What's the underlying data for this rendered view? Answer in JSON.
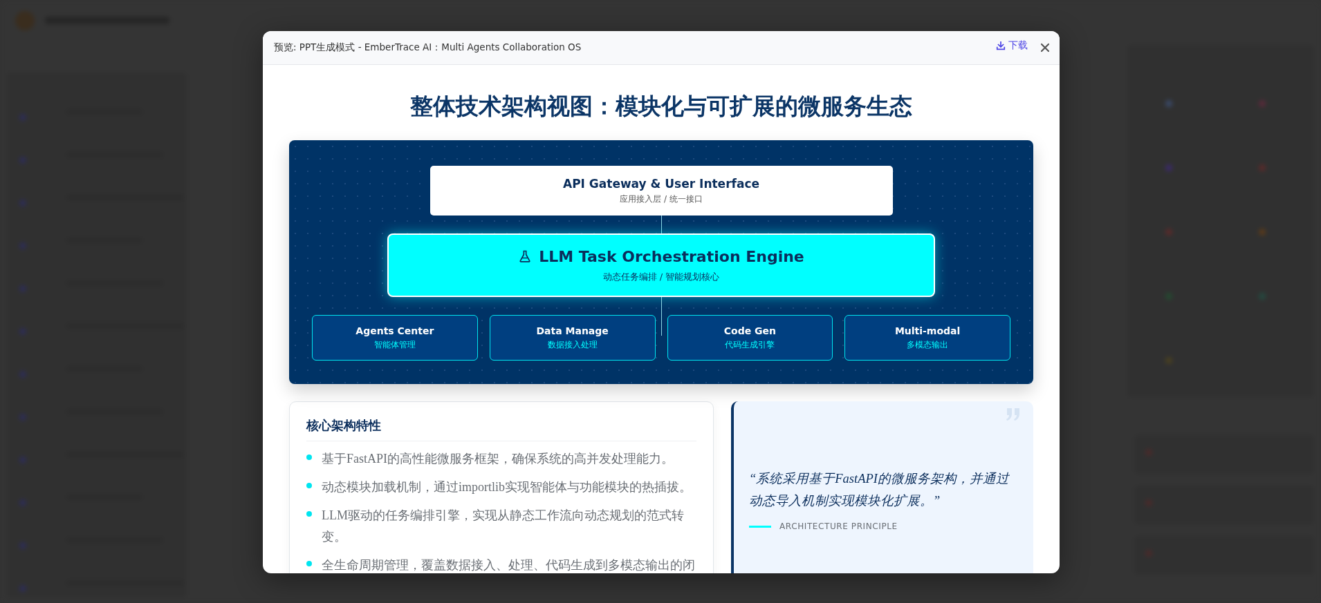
{
  "dialog": {
    "title": "预览: PPT生成模式 - EmberTrace AI：Multi Agents Collaboration OS",
    "download_label": "下载"
  },
  "slide": {
    "title": "整体技术架构视图：模块化与可扩展的微服务生态",
    "architecture": {
      "gateway": {
        "title": "API Gateway & User Interface",
        "subtitle": "应用接入层 / 统一接口"
      },
      "engine": {
        "title": "LLM Task Orchestration Engine",
        "subtitle": "动态任务编排 / 智能规划核心"
      },
      "modules": [
        {
          "title": "Agents Center",
          "subtitle": "智能体管理"
        },
        {
          "title": "Data Manage",
          "subtitle": "数据接入处理"
        },
        {
          "title": "Code Gen",
          "subtitle": "代码生成引擎"
        },
        {
          "title": "Multi-modal",
          "subtitle": "多模态输出"
        }
      ]
    },
    "features": {
      "heading": "核心架构特性",
      "items": [
        "基于FastAPI的高性能微服务框架，确保系统的高并发处理能力。",
        "动态模块加载机制，通过importlib实现智能体与功能模块的热插拔。",
        "LLM驱动的任务编排引擎，实现从静态工作流向动态规划的范式转变。",
        "全生命周期管理，覆盖数据接入、处理、代码生成到多模态输出的闭"
      ]
    },
    "quote": {
      "text": "“系统采用基于FastAPI的微服务架构，并通过动态导入机制实现模块化扩展。”",
      "caption": "ARCHITECTURE PRINCIPLE"
    }
  }
}
